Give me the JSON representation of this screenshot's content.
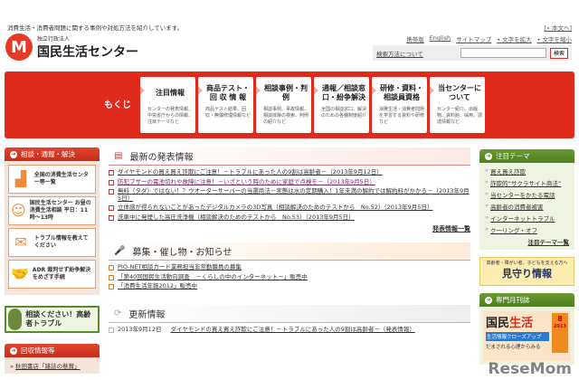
{
  "header": {
    "tagline": "消費生活・消費者問題に関する事例や対処方法を紹介しています。",
    "skip_link": "[» 本文へ]",
    "logo_sub": "独立行政法人",
    "logo_main": "国民生活センター",
    "util_links": [
      "携帯版",
      "English",
      "サイトマップ",
      "• 文字を拡大",
      "• 文字を縮小"
    ],
    "search_help": "検索方法について",
    "search_placeholder": "",
    "search_button": "検索"
  },
  "nav": {
    "label": "もくじ",
    "cards": [
      {
        "title": "注目情報",
        "desc": "センターの発表情報、中央省庁からの情報、注目テーマなど"
      },
      {
        "title": "商品テスト・回 収 情 報",
        "desc": "商品テスト結果、回収・無償修理情報など"
      },
      {
        "title": "相談事例・判　　例",
        "desc": "相談事例、事故情報、相談体験の検索、判例の紹介など"
      },
      {
        "title": "通報／相談窓口・紛争解決",
        "desc": "全国の相談窓口、解決のための各種制度紹介"
      },
      {
        "title": "研修・資料・相談員資格",
        "desc": "消費生活・消費者問題を学習する資料や研修など"
      },
      {
        "title": "当センターについて",
        "desc": "センター紹介、出版物、資料館、採用、調達情報など"
      }
    ]
  },
  "left": {
    "header": "相談・通報・解決",
    "cards": [
      {
        "icon": "japan-map-icon",
        "text": "全国の消費生活センター等一覧"
      },
      {
        "icon": "operator-icon",
        "text": "国民生活センター お昼の消費生活相談 平日：11時〜13時"
      },
      {
        "icon": "mail-icon",
        "text": "トラブル情報を教えてください"
      },
      {
        "icon": "handshake-icon",
        "text": "ADR 裁判せず紛争解決をめざす手続"
      }
    ],
    "banner": "相談ください！高齢者トラブル",
    "recall_header": "回収情報等",
    "recall_link": "秋田書店「雑誌の懸賞」"
  },
  "main": {
    "latest": {
      "title": "最新の発表情報",
      "items": [
        "ダイヤモンドの買え買え詐欺にご注意！－トラブルにあった人の9割は高齢者－（2013年9月12日）",
        "防犯ブザーの電池切れや故障に注意！－いざという時のために家庭で点検を－（2013年9月5日）",
        "無料（タダ）ではない！？ウオーターサーバーの当選商法－実態は水の定期購入！1年未満の解約では解約料がかかる－（2013年9月5日）",
        "立体感が得られないことがあったデジタルカメラの3D写真（相談解決のためのテストから　No.52）（2013年9月5日）",
        "洗車中に発煙した高圧洗浄機（相談解決のためのテストから　No.53）（2013年9月5日）"
      ],
      "more": "発表情報一覧"
    },
    "events": {
      "title": "募集・催し物・お知らせ",
      "items": [
        "PIO-NET相談カード業務担当非常勤職員の募集",
        "「第40回国民生活動向調査　－くらしの中のインターネット－」販売中",
        "「消費生活年報2012」販売中"
      ]
    },
    "updates": {
      "title": "更新情報",
      "date": "2013年9月12日",
      "item": "ダイヤモンドの買え買え詐欺にご注意！－トラブルにあった人の9割は高齢者－（発表情報）"
    }
  },
  "right": {
    "themes_header": "注目テーマ",
    "themes": [
      "買え買え詐欺",
      "詐欺的“サクラサイト商法”",
      "当センターをかたる電話",
      "高齢者の消費者被害",
      "インターネットトラブル",
      "クーリング・オフ"
    ],
    "themes_more": "注目テーマ一覧",
    "mimamori_sub": "高齢者・障がい者、子どもを支える方へ",
    "mimamori_title": "見守り情報",
    "magazine_header": "専門月刊誌",
    "magazine_title_a": "国民",
    "magazine_title_b": "生活",
    "magazine_no": "8",
    "magazine_year": "2013",
    "magazine_bar": "生活情報クローズアップ",
    "magazine_sub": "だまされる心理からみる"
  },
  "watermark": "ReseMom"
}
